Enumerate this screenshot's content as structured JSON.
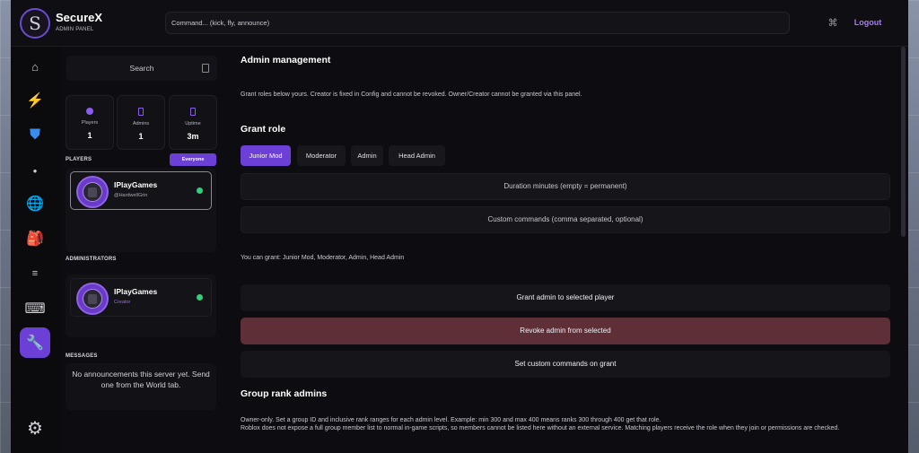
{
  "app": {
    "title": "SecureX",
    "subtitle": "ADMIN PANEL",
    "logo_letter": "S"
  },
  "header": {
    "command_placeholder": "Command... (kick, fly, announce)",
    "logout_label": "Logout",
    "keybind_icon": "⌘"
  },
  "colors": {
    "accent": "#6c3fd6",
    "danger": "#5e2f36",
    "online": "#2fd07a",
    "panel": "#0d0d11"
  },
  "rail": {
    "items": [
      {
        "name": "home-icon",
        "glyph": "⌂",
        "color": "#cfcfd6"
      },
      {
        "name": "lightning-icon",
        "glyph": "⚡",
        "color": "#f5c542"
      },
      {
        "name": "shield-icon",
        "glyph": "⛊",
        "color": "#3a8df0"
      },
      {
        "name": "dot-icon",
        "glyph": "●",
        "color": "#cfcfd6"
      },
      {
        "name": "globe-icon",
        "glyph": "🌐",
        "color": "#3a8df0"
      },
      {
        "name": "backpack-icon",
        "glyph": "🎒",
        "color": "#e04848"
      },
      {
        "name": "menu-icon",
        "glyph": "≡",
        "color": "#cfcfd6"
      },
      {
        "name": "keyboard-icon",
        "glyph": "⌨",
        "color": "#cfcfd6"
      },
      {
        "name": "wrench-icon",
        "glyph": "🔧",
        "color": "#ffffff"
      },
      {
        "name": "gear-icon",
        "glyph": "⚙",
        "color": "#cfcfd6"
      }
    ]
  },
  "side": {
    "search_label": "Search",
    "stats": [
      {
        "label": "Players",
        "value": "1"
      },
      {
        "label": "Admins",
        "value": "1"
      },
      {
        "label": "Uptime",
        "value": "3m"
      }
    ],
    "players_label": "PLAYERS",
    "everyone_label": "Everyone",
    "players": [
      {
        "name": "IPlayGames",
        "handle": "@HardwellGrin"
      }
    ],
    "administrators_label": "ADMINISTRATORS",
    "admins": [
      {
        "name": "IPlayGames",
        "role": "Creator"
      }
    ],
    "messages_label": "MESSAGES",
    "messages_empty": "No announcements this server yet. Send one from the World tab."
  },
  "main": {
    "title": "Admin management",
    "intro": "Grant roles below yours. Creator is fixed in Config and cannot be revoked. Owner/Creator cannot be granted via this panel.",
    "grant_title": "Grant role",
    "roles": [
      "Junior Mod",
      "Moderator",
      "Admin",
      "Head Admin"
    ],
    "selected_role": "Junior Mod",
    "duration_placeholder": "Duration minutes (empty = permanent)",
    "custom_commands_placeholder": "Custom commands (comma separated, optional)",
    "can_grant": "You can grant: Junior Mod, Moderator, Admin, Head Admin",
    "grant_button": "Grant admin to selected player",
    "revoke_button": "Revoke admin from selected",
    "set_custom_button": "Set custom commands on grant",
    "group_title": "Group rank admins",
    "group_text_1": "Owner-only. Set a group ID and inclusive rank ranges for each admin level. Example: min 300 and max 400 means ranks 300 through 400 get that role.",
    "group_text_2": "Roblox does not expose a full group member list to normal in-game scripts, so members cannot be listed here without an external service. Matching players receive the role when they join or permissions are checked."
  }
}
